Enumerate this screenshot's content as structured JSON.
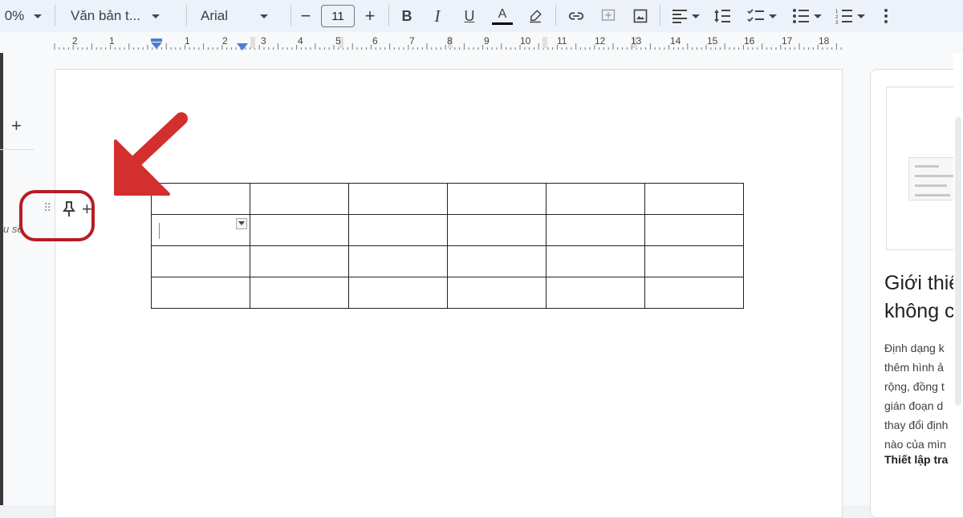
{
  "toolbar": {
    "zoom_fragment": "0%",
    "style_select": "Văn bản t...",
    "font_select": "Arial",
    "font_size": "11",
    "decrease_symbol": "−",
    "increase_symbol": "+",
    "bold_label": "B",
    "italic_label": "I",
    "underline_label": "U",
    "text_color_label": "A",
    "text_color": "#000000",
    "icons": [
      "highlighter-icon",
      "link-icon",
      "add-comment-icon",
      "insert-image-icon",
      "align-left-icon",
      "line-spacing-icon",
      "checklist-icon",
      "bullet-list-icon",
      "numbered-list-icon",
      "more-icon"
    ]
  },
  "ruler": {
    "labels": [
      "2",
      "1",
      "1",
      "2",
      "3",
      "4",
      "5",
      "6",
      "7",
      "8",
      "9",
      "10",
      "11",
      "12",
      "13",
      "14",
      "15",
      "16",
      "17",
      "18"
    ]
  },
  "left_panel": {
    "add_symbol": "+",
    "truncated_text": "u sẽ"
  },
  "document": {
    "table": {
      "rows": 4,
      "columns": 6
    },
    "row_chip": {
      "drag_handle": "⠿",
      "pin_icon": "pin-icon",
      "add_symbol": "+"
    },
    "annotation": {
      "color": "#d32f2f"
    }
  },
  "side_panel": {
    "title_line1": "Giới thiệ",
    "title_line2": "không c",
    "body_lines": [
      "Định dạng k",
      "thêm hình ả",
      "rộng, đồng t",
      "gián đoạn d",
      "thay đổi định",
      "nào của mìn"
    ],
    "bold_line": "Thiết lập tra"
  }
}
